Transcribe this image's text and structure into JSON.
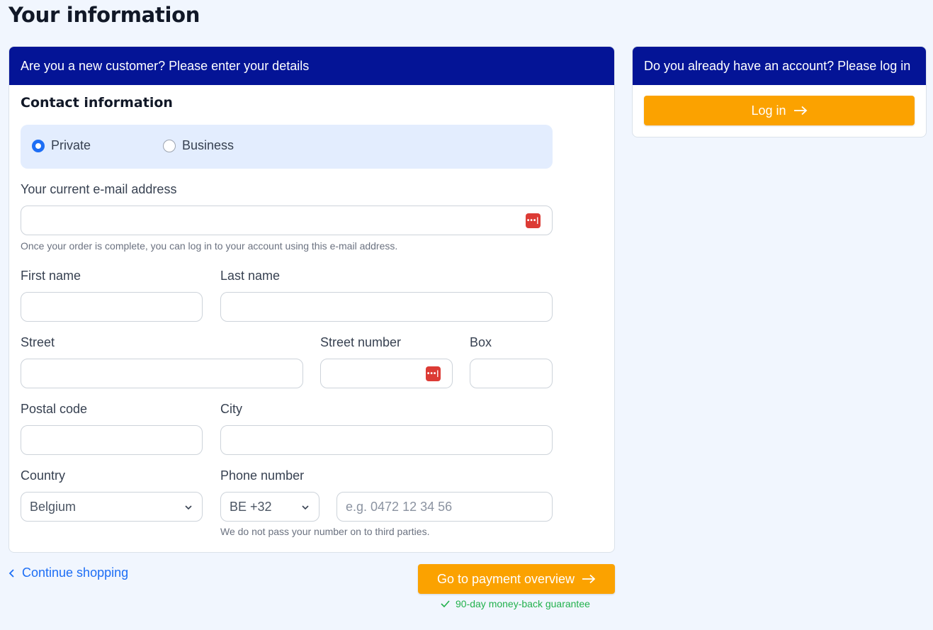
{
  "page": {
    "title": "Your information"
  },
  "new_customer": {
    "header": "Are you a new customer? Please enter your details",
    "section_title": "Contact information",
    "customer_type": {
      "options": [
        "Private",
        "Business"
      ],
      "selected": "Private"
    },
    "email": {
      "label": "Your current e-mail address",
      "value": "",
      "hint": "Once your order is complete, you can log in to your account using this e-mail address."
    },
    "first_name": {
      "label": "First name",
      "value": ""
    },
    "last_name": {
      "label": "Last name",
      "value": ""
    },
    "street": {
      "label": "Street",
      "value": ""
    },
    "street_number": {
      "label": "Street number",
      "value": ""
    },
    "box": {
      "label": "Box",
      "value": ""
    },
    "postal_code": {
      "label": "Postal code",
      "value": ""
    },
    "city": {
      "label": "City",
      "value": ""
    },
    "country": {
      "label": "Country",
      "value": "Belgium"
    },
    "phone": {
      "label": "Phone number",
      "prefix": "BE +32",
      "placeholder": "e.g. 0472 12 34 56",
      "hint": "We do not pass your number on to third parties."
    }
  },
  "existing_customer": {
    "header": "Do you already have an account? Please log in",
    "login_label": "Log in"
  },
  "footer": {
    "continue_label": "Continue shopping",
    "payment_label": "Go to payment overview",
    "guarantee": "90-day money-back guarantee"
  },
  "icons": {
    "password_manager": "password-manager-icon",
    "chevron_down": "chevron-down-icon",
    "arrow_right": "arrow-right-icon",
    "chevron_left": "chevron-left-icon",
    "check": "check-icon"
  },
  "colors": {
    "header_bg": "#041496",
    "accent_orange": "#fba200",
    "link_blue": "#1d6ef5",
    "success_green": "#22b14c",
    "page_bg": "#f1f6fe",
    "radio_box_bg": "#e3edfe",
    "password_icon_red": "#dc3b35"
  }
}
